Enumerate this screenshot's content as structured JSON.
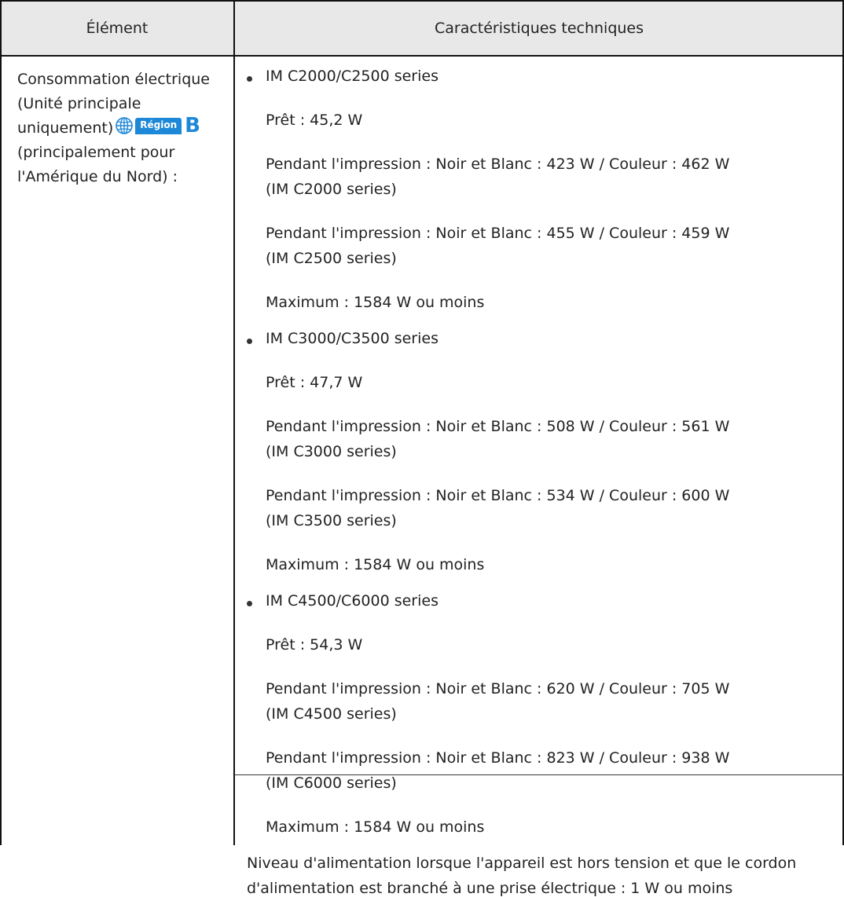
{
  "header": {
    "col1": "Élément",
    "col2": "Caractéristiques techniques"
  },
  "left": {
    "lines": [
      "Consommation électrique",
      "(Unité principale",
      "uniquement)",
      "(principalement pour",
      "l'Amérique du Nord) :"
    ],
    "region_label": "Région",
    "region_letter": "B",
    "region_icon": "globe-icon"
  },
  "groups": [
    {
      "model": "IM C2000/C2500 series",
      "ready": "Prêt : 45,2 W",
      "printing": [
        {
          "line1": "Pendant l'impression : Noir et Blanc : 423 W / Couleur : 462 W",
          "line2": "(IM C2000 series)"
        },
        {
          "line1": "Pendant l'impression : Noir et Blanc : 455 W / Couleur : 459 W",
          "line2": "(IM C2500 series)"
        }
      ],
      "maximum": "Maximum : 1584 W ou moins"
    },
    {
      "model": "IM C3000/C3500 series",
      "ready": "Prêt : 47,7 W",
      "printing": [
        {
          "line1": "Pendant l'impression : Noir et Blanc : 508 W / Couleur : 561 W",
          "line2": "(IM C3000 series)"
        },
        {
          "line1": "Pendant l'impression : Noir et Blanc : 534 W / Couleur : 600 W",
          "line2": "(IM C3500 series)"
        }
      ],
      "maximum": "Maximum : 1584 W ou moins"
    },
    {
      "model": "IM C4500/C6000 series",
      "ready": "Prêt : 54,3 W",
      "printing": [
        {
          "line1": "Pendant l'impression : Noir et Blanc : 620 W / Couleur : 705 W",
          "line2": "(IM C4500 series)"
        },
        {
          "line1": "Pendant l'impression : Noir et Blanc : 823 W / Couleur : 938 W",
          "line2": "(IM C6000 series)"
        }
      ],
      "maximum": "Maximum : 1584 W ou moins"
    }
  ],
  "footer_note": {
    "line1": "Niveau d'alimentation lorsque l'appareil est hors tension et que le cordon",
    "line2": "d'alimentation est branché à une prise électrique : 1 W ou moins"
  },
  "colors": {
    "header_bg": "#e8e8e8",
    "region_blue": "#1e88d8"
  }
}
